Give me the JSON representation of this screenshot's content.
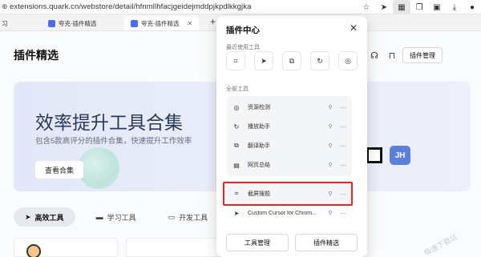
{
  "browser": {
    "url": "extensions.quark.cn/webstore/detail/hfnmllhfacjgeidejmddpjkpdlkkgjka",
    "toolbar_icons": [
      "star-icon",
      "cursor-icon",
      "puzzle-icon",
      "copy-icon",
      "save-icon",
      "download-icon",
      "avatar-icon"
    ],
    "tabs": [
      {
        "label": "习",
        "active": false
      },
      {
        "label": "夸克-插件精选",
        "active": false
      },
      {
        "label": "夸克-插件精选",
        "active": true
      }
    ],
    "new_tab": "+"
  },
  "page": {
    "title": "插件精选",
    "plugin_manager": "插件管理",
    "banner": {
      "title": "效率提升工具合集",
      "subtitle": "包含5款高评分的插件合集，快速提升工作效率",
      "button": "查看合集",
      "badge": "JH"
    },
    "categories": [
      {
        "label": "高效工具",
        "icon": "send-icon",
        "active": true
      },
      {
        "label": "学习工具",
        "icon": "book-icon",
        "active": false
      },
      {
        "label": "开发工具",
        "icon": "code-icon",
        "active": false
      }
    ],
    "watermark": "极速下载站"
  },
  "popup": {
    "title": "插件中心",
    "recent_label": "最近使用工具",
    "recent_icons": [
      "scan-icon",
      "cursor-icon",
      "translate-icon",
      "refresh-icon",
      "podcast-icon"
    ],
    "all_label": "全部工具",
    "tools": [
      {
        "label": "资源检测",
        "icon": "podcast-icon"
      },
      {
        "label": "播放助手",
        "icon": "refresh-icon"
      },
      {
        "label": "翻译助手",
        "icon": "translate-icon"
      },
      {
        "label": "网页总结",
        "icon": "summary-icon"
      },
      {
        "label": "截屏搜题",
        "icon": "scan-icon"
      },
      {
        "label": "Custom Cursor for Chrom...",
        "icon": "cursor-icon"
      }
    ],
    "buttons": {
      "manage": "工具管理",
      "featured": "插件精选"
    }
  },
  "colors": {
    "accent_red": "#ee2222",
    "banner_bg": "#e2e8f8",
    "badge_blue": "#5d7fdc"
  }
}
